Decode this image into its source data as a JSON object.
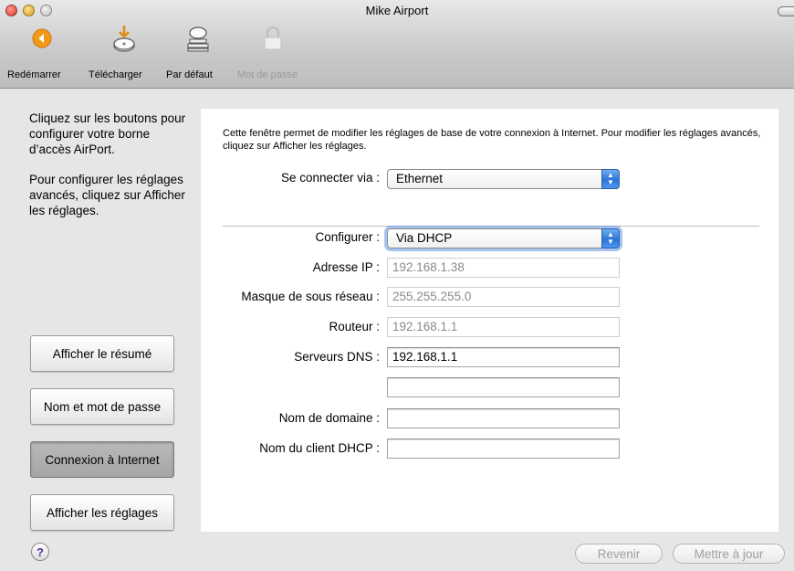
{
  "window": {
    "title": "Mike Airport"
  },
  "toolbar": {
    "items": [
      {
        "label": "Redémarrer",
        "icon": "restart-icon",
        "enabled": true
      },
      {
        "label": "Télécharger",
        "icon": "download-icon",
        "enabled": true
      },
      {
        "label": "Par défaut",
        "icon": "default-icon",
        "enabled": true
      },
      {
        "label": "Mot de passe",
        "icon": "lock-icon",
        "enabled": false
      }
    ]
  },
  "sidebar": {
    "help_text_1": "Cliquez sur les boutons pour configurer votre borne d’accès AirPort.",
    "help_text_2": "Pour configurer les réglages avancés, cliquez sur Afficher les réglages.",
    "buttons": [
      {
        "label": "Afficher le résumé"
      },
      {
        "label": "Nom et mot de passe"
      },
      {
        "label": "Connexion à Internet",
        "selected": true
      },
      {
        "label": "Afficher les réglages"
      }
    ]
  },
  "content": {
    "intro": "Cette fenêtre permet de modifier les réglages de base de votre connexion à Internet. Pour modifier les réglages avancés, cliquez sur Afficher les réglages.",
    "connect_via": {
      "label": "Se connecter via :",
      "value": "Ethernet"
    },
    "configure": {
      "label": "Configurer :",
      "value": "Via DHCP"
    },
    "fields": {
      "ip": {
        "label": "Adresse IP :",
        "value": "192.168.1.38"
      },
      "mask": {
        "label": "Masque de sous réseau :",
        "value": "255.255.255.0"
      },
      "router": {
        "label": "Routeur :",
        "value": "192.168.1.1"
      },
      "dns": {
        "label": "Serveurs DNS :",
        "value": "192.168.1.1",
        "value2": ""
      },
      "domain": {
        "label": "Nom de domaine :",
        "value": ""
      },
      "dhcp_client": {
        "label": "Nom du client DHCP :",
        "value": ""
      }
    }
  },
  "footer": {
    "help": "?",
    "revert_label": "Revenir",
    "update_label": "Mettre à jour"
  },
  "colors": {
    "accent": "#2a74d6",
    "selected_button": "#a6a6a6"
  }
}
